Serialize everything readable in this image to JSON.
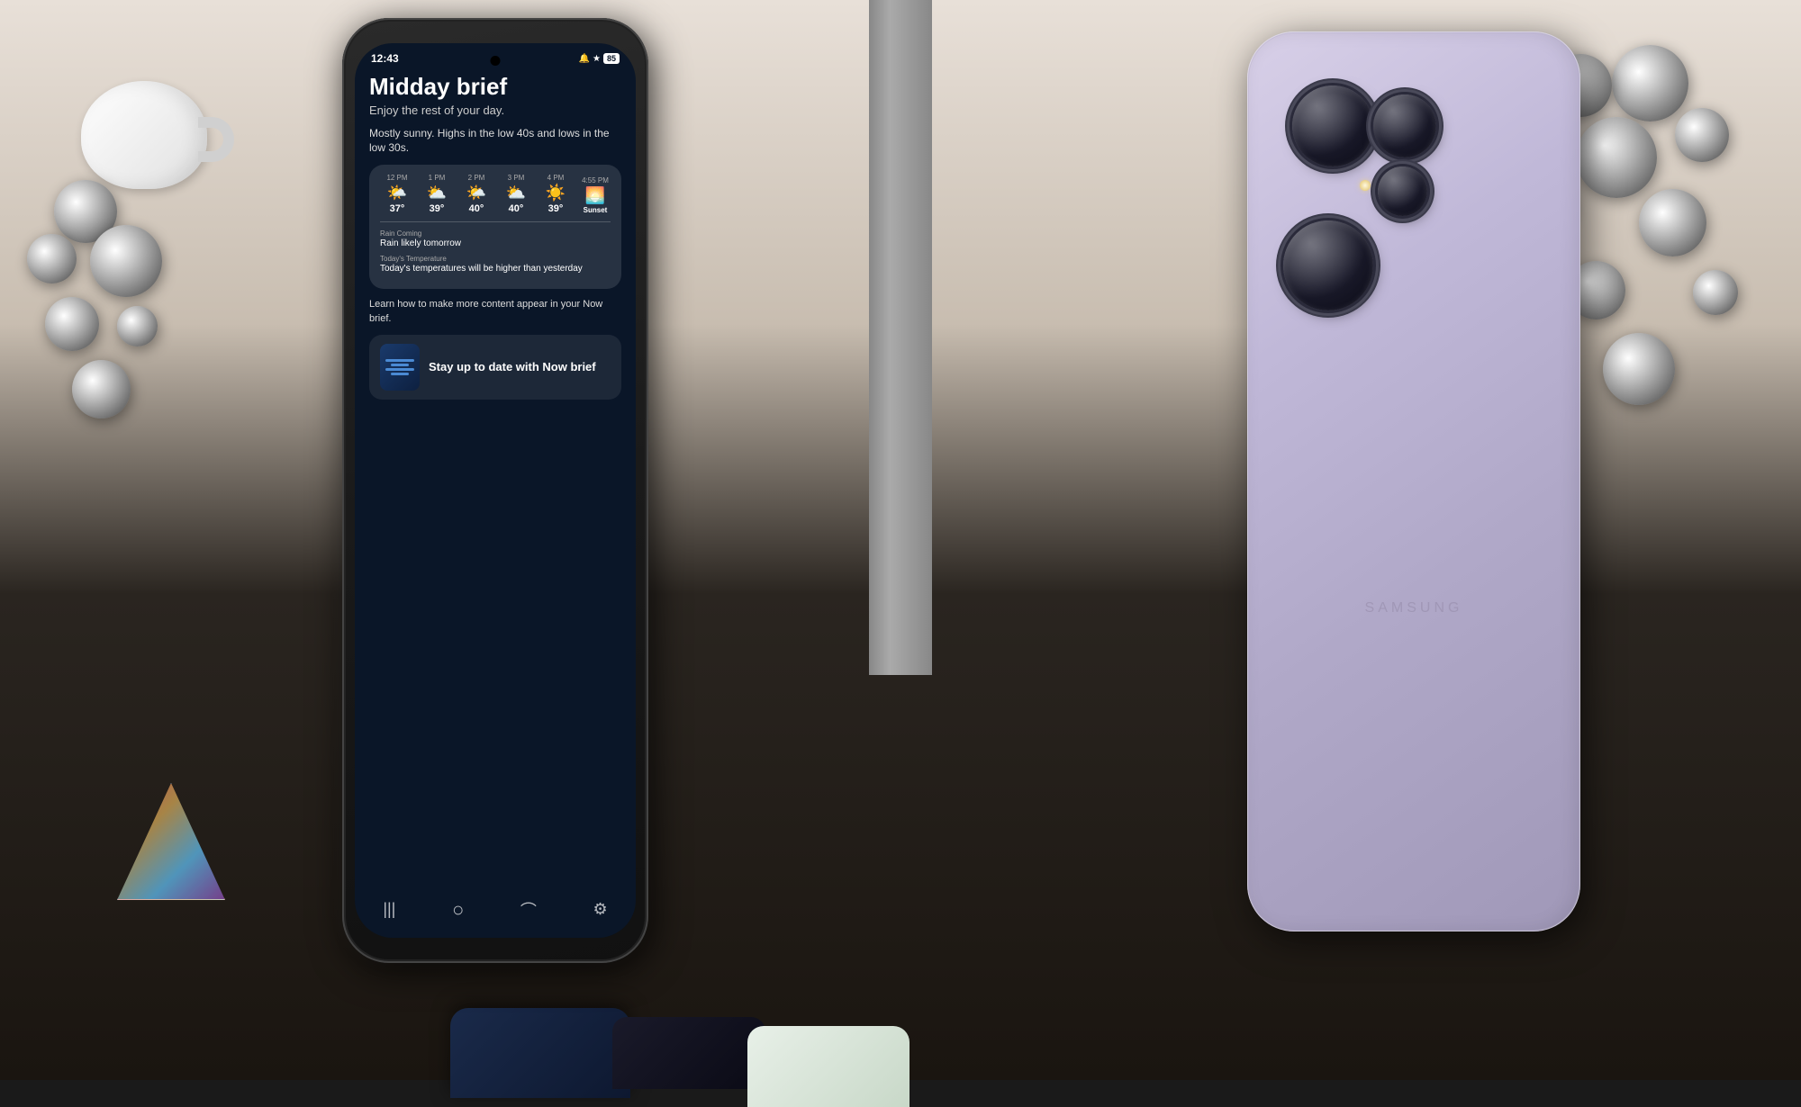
{
  "background": {
    "color_top": "#e8e0d8",
    "color_bottom": "#1a1510"
  },
  "phone_front": {
    "status_bar": {
      "time": "12:43",
      "icons": "🔔 ★ 85"
    },
    "screen": {
      "title": "Midday brief",
      "subtitle": "Enjoy the rest of your day.",
      "weather_desc": "Mostly sunny. Highs in the low 40s and lows in the low 30s.",
      "weather_hours": [
        {
          "label": "12 PM",
          "emoji": "🌤️",
          "temp": "37°"
        },
        {
          "label": "1 PM",
          "emoji": "⛅",
          "temp": "39°"
        },
        {
          "label": "2 PM",
          "emoji": "🌤️",
          "temp": "40°"
        },
        {
          "label": "3 PM",
          "emoji": "⛅",
          "temp": "40°"
        },
        {
          "label": "4 PM",
          "emoji": "☀️",
          "temp": "39°"
        },
        {
          "label": "4:55 PM",
          "emoji": "🌅",
          "temp": "Sunset"
        }
      ],
      "rain_label": "Rain Coming",
      "rain_value": "Rain likely tomorrow",
      "temp_label": "Today's Temperature",
      "temp_value": "Today's temperatures will be higher than yesterday",
      "learn_more": "Learn how to make more content appear in your Now brief.",
      "now_brief_card": {
        "title": "Stay up to date with Now brief"
      }
    },
    "nav": {
      "back": "‹",
      "home": "○",
      "recents": "|||"
    }
  },
  "phone_back": {
    "brand": "SAMSUNG",
    "camera": {
      "lenses": [
        "main",
        "telephoto",
        "ultrawide",
        "periscope"
      ],
      "sensor_color": "#e0c060"
    }
  }
}
